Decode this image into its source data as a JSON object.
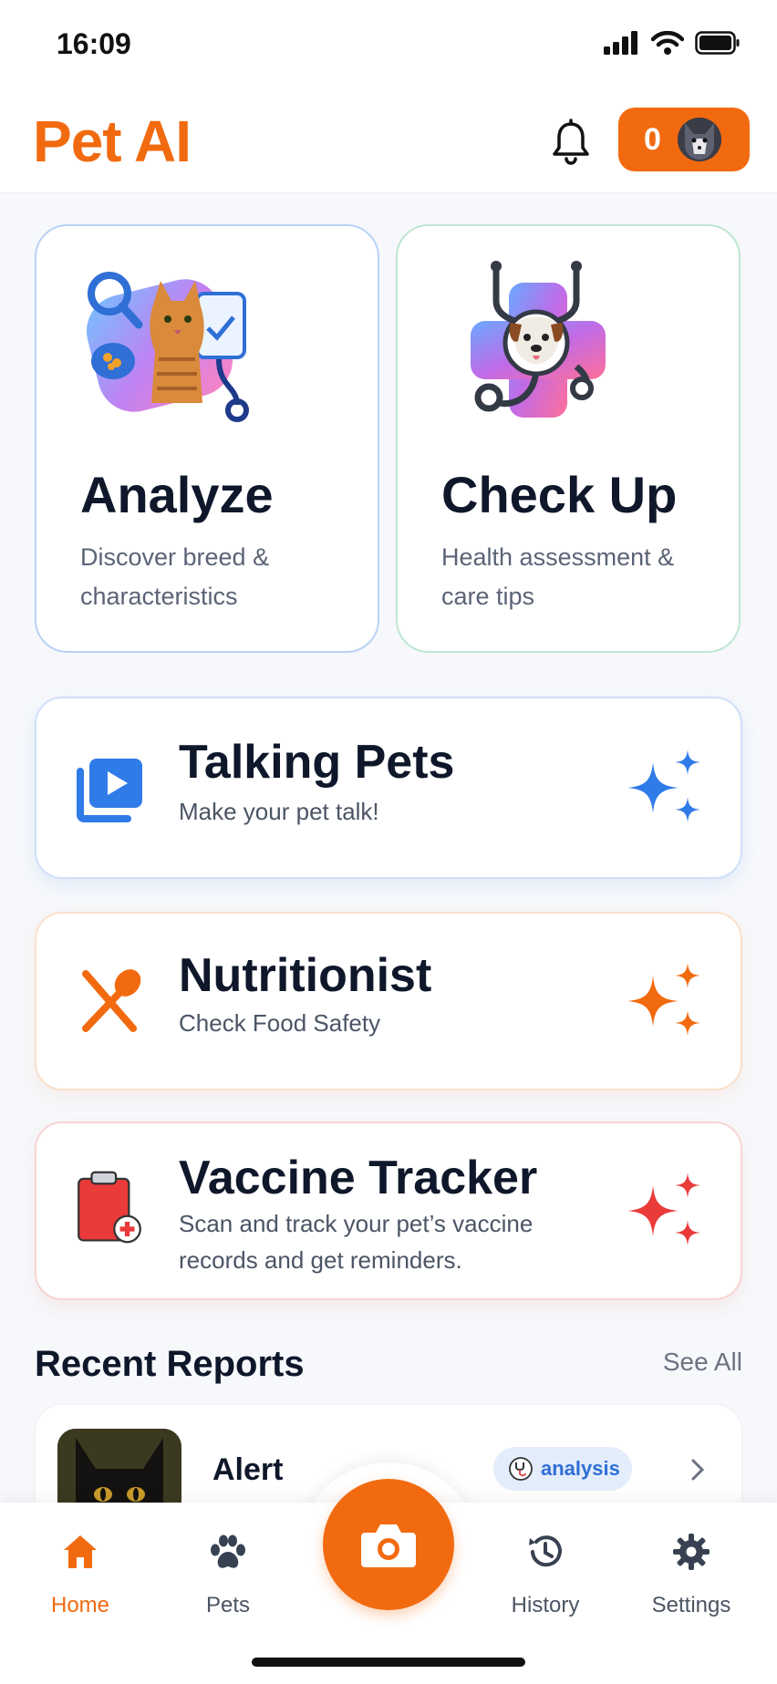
{
  "status_bar": {
    "time": "16:09"
  },
  "header": {
    "title": "Pet AI",
    "coin_count": "0"
  },
  "top_cards": [
    {
      "title": "Analyze",
      "desc": "Discover breed & characteristics"
    },
    {
      "title": "Check Up",
      "desc": "Health assessment & care tips"
    }
  ],
  "features": [
    {
      "title": "Talking Pets",
      "desc": "Make your pet talk!",
      "accent": "#2f7be8"
    },
    {
      "title": "Nutritionist",
      "desc": "Check Food Safety",
      "accent": "#f26a10"
    },
    {
      "title": "Vaccine Tracker",
      "desc": "Scan and track your pet’s vaccine records and get reminders.",
      "accent": "#ea3a3a"
    }
  ],
  "recent": {
    "title": "Recent Reports",
    "see_all": "See All",
    "items": [
      {
        "title": "Alert",
        "badge": "analysis"
      }
    ]
  },
  "nav": {
    "home": "Home",
    "pets": "Pets",
    "history": "History",
    "settings": "Settings"
  },
  "colors": {
    "brand": "#f26a10",
    "blue": "#2f7be8",
    "red": "#ea3a3a"
  }
}
